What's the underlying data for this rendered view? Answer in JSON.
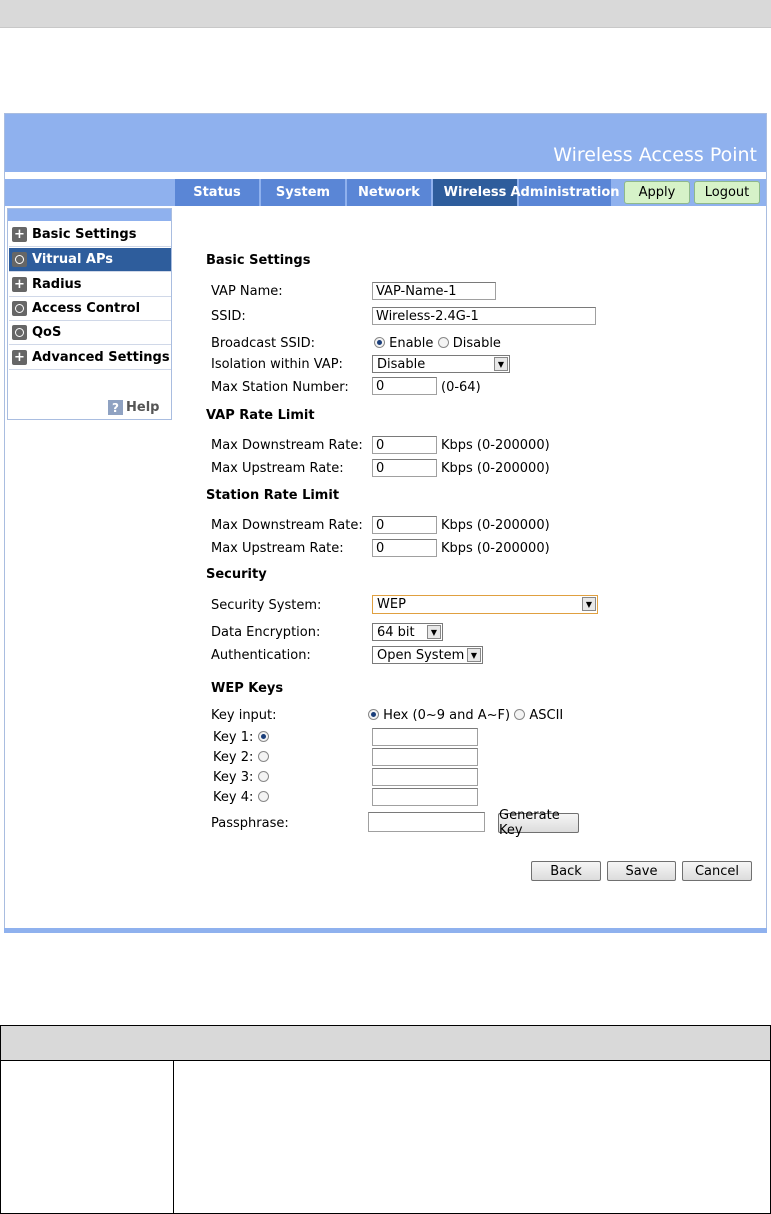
{
  "header": {
    "title": "Wireless Access Point"
  },
  "nav": {
    "tabs": [
      {
        "label": "Status"
      },
      {
        "label": "System"
      },
      {
        "label": "Network"
      },
      {
        "label": "Wireless"
      },
      {
        "label": "Administration"
      }
    ],
    "active_tab": "Wireless",
    "apply_label": "Apply",
    "logout_label": "Logout"
  },
  "sidebar": {
    "items": [
      {
        "label": "Basic Settings",
        "icon": "plus-icon"
      },
      {
        "label": "Vitrual APs",
        "icon": "circle-icon"
      },
      {
        "label": "Radius",
        "icon": "plus-icon"
      },
      {
        "label": "Access Control",
        "icon": "circle-icon"
      },
      {
        "label": "QoS",
        "icon": "circle-icon"
      },
      {
        "label": "Advanced Settings",
        "icon": "plus-icon"
      }
    ],
    "active_item": "Vitrual APs",
    "help_label": "Help"
  },
  "basic": {
    "heading": "Basic Settings",
    "vap_name_label": "VAP Name:",
    "vap_name_value": "VAP-Name-1",
    "ssid_label": "SSID:",
    "ssid_value": "Wireless-2.4G-1",
    "broadcast_label": "Broadcast SSID:",
    "broadcast_enable": "Enable",
    "broadcast_disable": "Disable",
    "isolation_label": "Isolation within VAP:",
    "isolation_value": "Disable",
    "max_station_label": "Max Station Number:",
    "max_station_value": "0",
    "max_station_range": "(0-64)"
  },
  "vap_rate": {
    "heading": "VAP Rate Limit",
    "down_label": "Max Downstream Rate:",
    "down_value": "0",
    "up_label": "Max Upstream Rate:",
    "up_value": "0",
    "unit": "Kbps (0-200000)"
  },
  "station_rate": {
    "heading": "Station Rate Limit",
    "down_label": "Max Downstream Rate:",
    "down_value": "0",
    "up_label": "Max Upstream Rate:",
    "up_value": "0",
    "unit": "Kbps (0-200000)"
  },
  "security": {
    "heading": "Security",
    "system_label": "Security System:",
    "system_value": "WEP",
    "encryption_label": "Data Encryption:",
    "encryption_value": "64 bit",
    "auth_label": "Authentication:",
    "auth_value": "Open System"
  },
  "wep": {
    "heading": "WEP Keys",
    "key_input_label": "Key input:",
    "hex_label": "Hex (0~9 and A~F)",
    "ascii_label": "ASCII",
    "keys": [
      {
        "label": "Key 1:",
        "value": ""
      },
      {
        "label": "Key 2:",
        "value": ""
      },
      {
        "label": "Key 3:",
        "value": ""
      },
      {
        "label": "Key 4:",
        "value": ""
      }
    ],
    "passphrase_label": "Passphrase:",
    "passphrase_value": "",
    "generate_label": "Generate Key"
  },
  "actions": {
    "back": "Back",
    "save": "Save",
    "cancel": "Cancel"
  }
}
